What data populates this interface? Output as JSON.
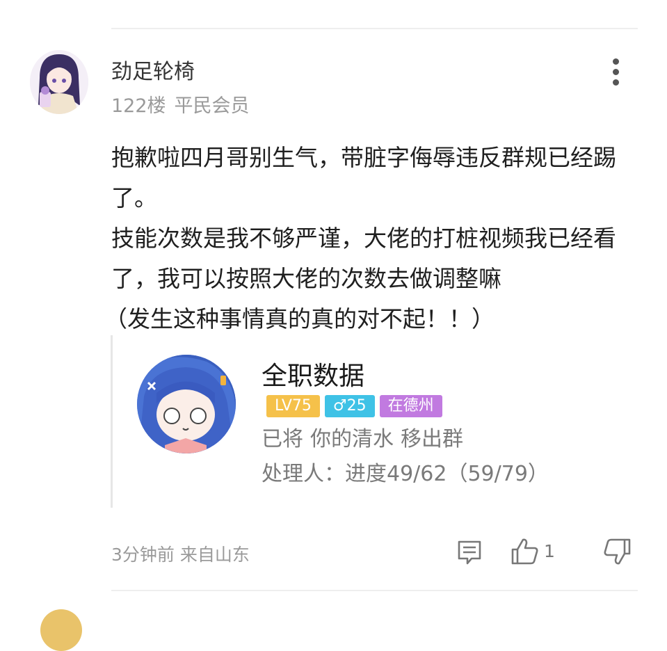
{
  "post": {
    "username": "劲足轮椅",
    "floor": "122楼",
    "member_level": "平民会员",
    "content_lines": [
      "抱歉啦四月哥别生气，带脏字侮辱违反群规已经踢了。",
      "技能次数是我不够严谨，大佬的打桩视频我已经看了，我可以按照大佬的次数去做调整嘛",
      "（发生这种事情真的真的对不起！！）"
    ],
    "quoted_card": {
      "name": "全职数据",
      "badge_level": "LV75",
      "badge_gender": "♂25",
      "badge_location": "在德州",
      "action_parts": [
        "已将",
        "你的清水",
        "移出群"
      ],
      "handler_line": "处理人：进度49/62（59/79）"
    },
    "time": "3分钟前",
    "source": "来自山东",
    "like_count": "1"
  },
  "icons": {
    "more": "more-vertical-icon",
    "comment": "comment-icon",
    "like": "thumbs-up-icon",
    "dislike": "thumbs-down-icon"
  },
  "colors": {
    "lv_badge": "#f5c14a",
    "gender_badge": "#3fc2e6",
    "location_badge": "#c17ae0",
    "meta_gray": "#9a9a9a"
  }
}
